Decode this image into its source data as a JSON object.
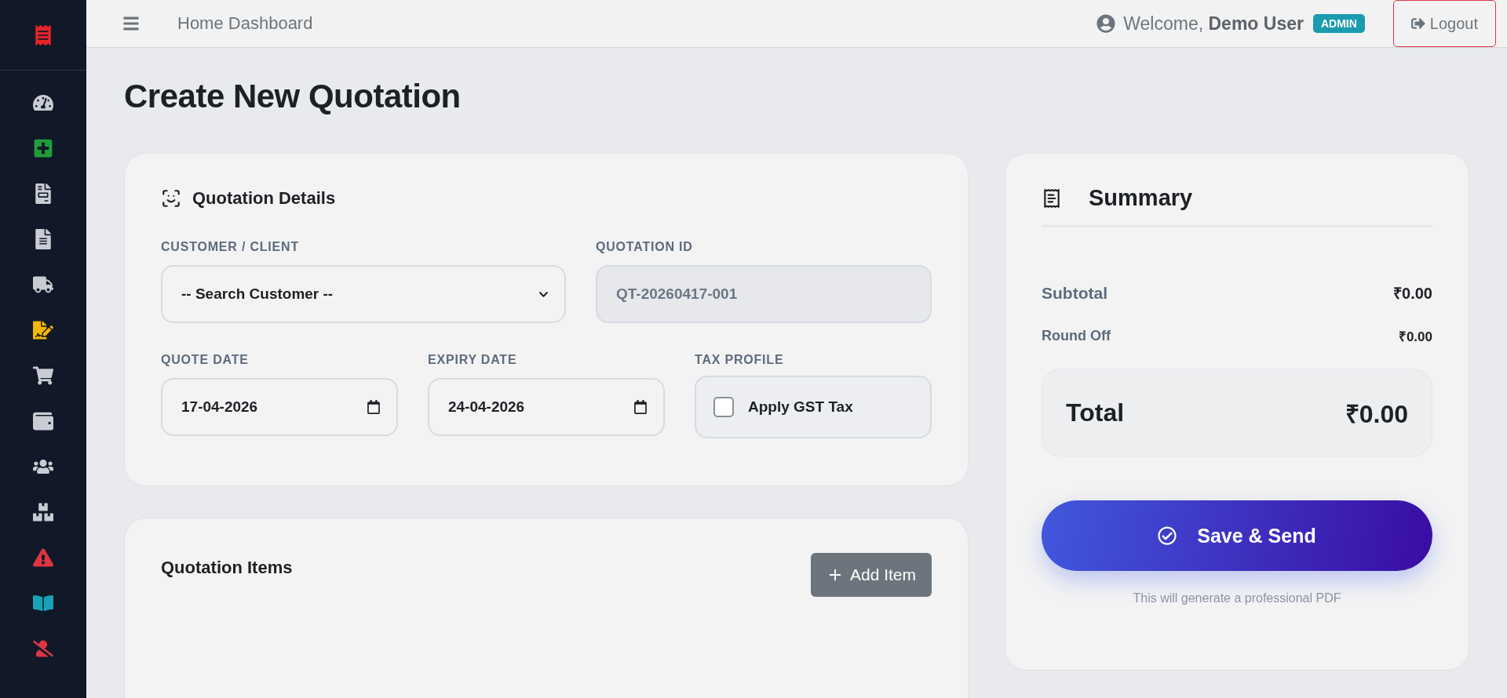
{
  "sidebar": {
    "items": [
      {
        "color": "#c9ccd3"
      },
      {
        "color": "#1f9d3a"
      },
      {
        "color": "#c9ccd3"
      },
      {
        "color": "#c9ccd3"
      },
      {
        "color": "#c9ccd3"
      },
      {
        "color": "#f2b705"
      },
      {
        "color": "#c9ccd3"
      },
      {
        "color": "#c9ccd3"
      },
      {
        "color": "#c9ccd3"
      },
      {
        "color": "#c9ccd3"
      },
      {
        "color": "#dc3545"
      },
      {
        "color": "#17a2b8"
      },
      {
        "color": "#dc3545"
      }
    ]
  },
  "topbar": {
    "title": "Home Dashboard",
    "welcome": "Welcome, **Demo User**",
    "role": "ADMIN",
    "logout": "Logout"
  },
  "page_title": "Create New Quotation",
  "details": {
    "title": "Quotation Details",
    "customer": {
      "label": "CUSTOMER / CLIENT",
      "value": "-- Search Customer --"
    },
    "quotation_id": {
      "label": "QUOTATION ID",
      "value": "QT-20260417-001",
      "disabled": true
    },
    "quote_date": {
      "label": "QUOTE DATE",
      "value": "17-04-2026"
    },
    "expiry_date": {
      "label": "EXPIRY DATE",
      "value": "24-04-2026"
    },
    "tax": {
      "label": "TAX PROFILE",
      "option": "Apply GST Tax",
      "checked": false
    }
  },
  "items": {
    "title": "Quotation Items",
    "add_button": "Add Item"
  },
  "summary": {
    "title": "Summary",
    "subtotal": {
      "label": "Subtotal",
      "value": "₹0.00"
    },
    "round_off": {
      "label": "Round Off",
      "value": "₹0.00"
    },
    "total": {
      "label": "Total",
      "value": "₹0.00"
    },
    "save_button": "Save & Send",
    "note": "This will generate a professional PDF"
  }
}
